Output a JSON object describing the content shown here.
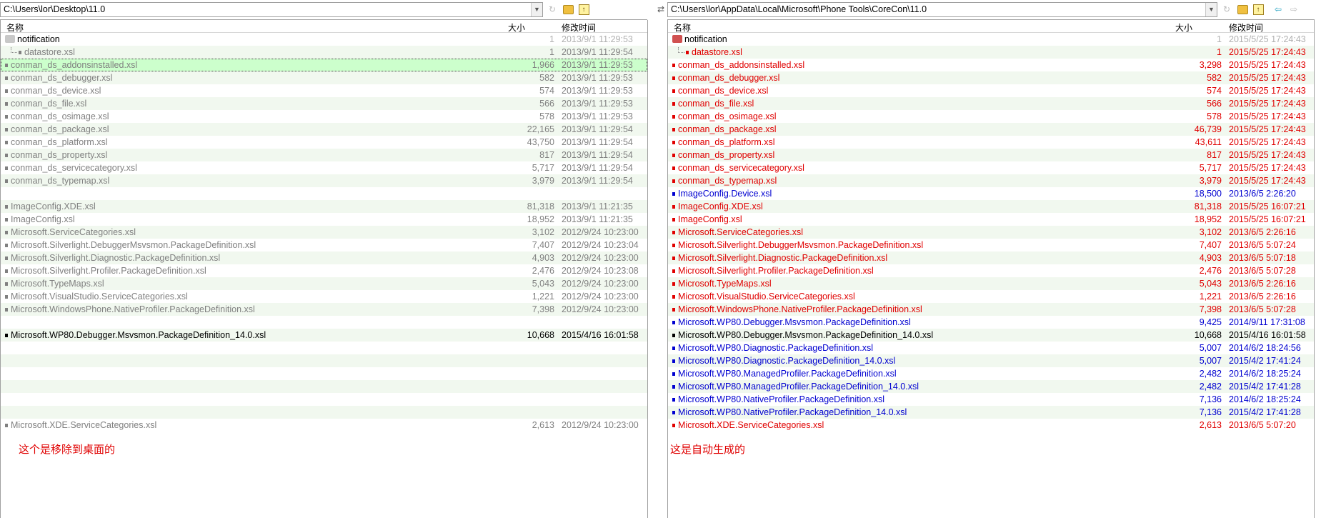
{
  "left": {
    "path": "C:\\Users\\lor\\Desktop\\11.0",
    "headers": {
      "name": "名称",
      "size": "大小",
      "date": "修改时间"
    },
    "note": "这个是移除到桌面的"
  },
  "right": {
    "path": "C:\\Users\\lor\\AppData\\Local\\Microsoft\\Phone Tools\\CoreCon\\11.0",
    "headers": {
      "name": "名称",
      "size": "大小",
      "date": "修改时间"
    },
    "note": "这是自动生成的"
  },
  "colors": {
    "gray": "#808080",
    "red": "#e00000",
    "blue": "#0000d0",
    "black": "#000000",
    "dim": "#b0b0b0"
  },
  "rows": [
    {
      "type": "folder",
      "left": {
        "name": "notification",
        "size": "1",
        "date": "2013/9/1 11:29:53",
        "color": "black",
        "meta": "dim"
      },
      "right": {
        "name": "notification",
        "size": "1",
        "date": "2015/5/25 17:24:43",
        "color": "black",
        "meta": "dim"
      }
    },
    {
      "type": "child",
      "left": {
        "name": "datastore.xsl",
        "size": "1",
        "date": "2013/9/1 11:29:54",
        "color": "gray"
      },
      "right": {
        "name": "datastore.xsl",
        "size": "1",
        "date": "2015/5/25 17:24:43",
        "color": "red"
      }
    },
    {
      "selected": true,
      "left": {
        "name": "conman_ds_addonsinstalled.xsl",
        "size": "1,966",
        "date": "2013/9/1 11:29:53",
        "color": "gray"
      },
      "right": {
        "name": "conman_ds_addonsinstalled.xsl",
        "size": "3,298",
        "date": "2015/5/25 17:24:43",
        "color": "red"
      }
    },
    {
      "left": {
        "name": "conman_ds_debugger.xsl",
        "size": "582",
        "date": "2013/9/1 11:29:53",
        "color": "gray"
      },
      "right": {
        "name": "conman_ds_debugger.xsl",
        "size": "582",
        "date": "2015/5/25 17:24:43",
        "color": "red"
      }
    },
    {
      "left": {
        "name": "conman_ds_device.xsl",
        "size": "574",
        "date": "2013/9/1 11:29:53",
        "color": "gray"
      },
      "right": {
        "name": "conman_ds_device.xsl",
        "size": "574",
        "date": "2015/5/25 17:24:43",
        "color": "red"
      }
    },
    {
      "left": {
        "name": "conman_ds_file.xsl",
        "size": "566",
        "date": "2013/9/1 11:29:53",
        "color": "gray"
      },
      "right": {
        "name": "conman_ds_file.xsl",
        "size": "566",
        "date": "2015/5/25 17:24:43",
        "color": "red"
      }
    },
    {
      "left": {
        "name": "conman_ds_osimage.xsl",
        "size": "578",
        "date": "2013/9/1 11:29:53",
        "color": "gray"
      },
      "right": {
        "name": "conman_ds_osimage.xsl",
        "size": "578",
        "date": "2015/5/25 17:24:43",
        "color": "red"
      }
    },
    {
      "left": {
        "name": "conman_ds_package.xsl",
        "size": "22,165",
        "date": "2013/9/1 11:29:54",
        "color": "gray"
      },
      "right": {
        "name": "conman_ds_package.xsl",
        "size": "46,739",
        "date": "2015/5/25 17:24:43",
        "color": "red"
      }
    },
    {
      "left": {
        "name": "conman_ds_platform.xsl",
        "size": "43,750",
        "date": "2013/9/1 11:29:54",
        "color": "gray"
      },
      "right": {
        "name": "conman_ds_platform.xsl",
        "size": "43,611",
        "date": "2015/5/25 17:24:43",
        "color": "red"
      }
    },
    {
      "left": {
        "name": "conman_ds_property.xsl",
        "size": "817",
        "date": "2013/9/1 11:29:54",
        "color": "gray"
      },
      "right": {
        "name": "conman_ds_property.xsl",
        "size": "817",
        "date": "2015/5/25 17:24:43",
        "color": "red"
      }
    },
    {
      "left": {
        "name": "conman_ds_servicecategory.xsl",
        "size": "5,717",
        "date": "2013/9/1 11:29:54",
        "color": "gray"
      },
      "right": {
        "name": "conman_ds_servicecategory.xsl",
        "size": "5,717",
        "date": "2015/5/25 17:24:43",
        "color": "red"
      }
    },
    {
      "left": {
        "name": "conman_ds_typemap.xsl",
        "size": "3,979",
        "date": "2013/9/1 11:29:54",
        "color": "gray"
      },
      "right": {
        "name": "conman_ds_typemap.xsl",
        "size": "3,979",
        "date": "2015/5/25 17:24:43",
        "color": "red"
      }
    },
    {
      "left": null,
      "right": {
        "name": "ImageConfig.Device.xsl",
        "size": "18,500",
        "date": "2013/6/5 2:26:20",
        "color": "blue"
      }
    },
    {
      "left": {
        "name": "ImageConfig.XDE.xsl",
        "size": "81,318",
        "date": "2013/9/1 11:21:35",
        "color": "gray"
      },
      "right": {
        "name": "ImageConfig.XDE.xsl",
        "size": "81,318",
        "date": "2015/5/25 16:07:21",
        "color": "red"
      }
    },
    {
      "left": {
        "name": "ImageConfig.xsl",
        "size": "18,952",
        "date": "2013/9/1 11:21:35",
        "color": "gray"
      },
      "right": {
        "name": "ImageConfig.xsl",
        "size": "18,952",
        "date": "2015/5/25 16:07:21",
        "color": "red"
      }
    },
    {
      "left": {
        "name": "Microsoft.ServiceCategories.xsl",
        "size": "3,102",
        "date": "2012/9/24 10:23:00",
        "color": "gray"
      },
      "right": {
        "name": "Microsoft.ServiceCategories.xsl",
        "size": "3,102",
        "date": "2013/6/5 2:26:16",
        "color": "red"
      }
    },
    {
      "left": {
        "name": "Microsoft.Silverlight.DebuggerMsvsmon.PackageDefinition.xsl",
        "size": "7,407",
        "date": "2012/9/24 10:23:04",
        "color": "gray"
      },
      "right": {
        "name": "Microsoft.Silverlight.DebuggerMsvsmon.PackageDefinition.xsl",
        "size": "7,407",
        "date": "2013/6/5 5:07:24",
        "color": "red"
      }
    },
    {
      "left": {
        "name": "Microsoft.Silverlight.Diagnostic.PackageDefinition.xsl",
        "size": "4,903",
        "date": "2012/9/24 10:23:00",
        "color": "gray"
      },
      "right": {
        "name": "Microsoft.Silverlight.Diagnostic.PackageDefinition.xsl",
        "size": "4,903",
        "date": "2013/6/5 5:07:18",
        "color": "red"
      }
    },
    {
      "left": {
        "name": "Microsoft.Silverlight.Profiler.PackageDefinition.xsl",
        "size": "2,476",
        "date": "2012/9/24 10:23:08",
        "color": "gray"
      },
      "right": {
        "name": "Microsoft.Silverlight.Profiler.PackageDefinition.xsl",
        "size": "2,476",
        "date": "2013/6/5 5:07:28",
        "color": "red"
      }
    },
    {
      "left": {
        "name": "Microsoft.TypeMaps.xsl",
        "size": "5,043",
        "date": "2012/9/24 10:23:00",
        "color": "gray"
      },
      "right": {
        "name": "Microsoft.TypeMaps.xsl",
        "size": "5,043",
        "date": "2013/6/5 2:26:16",
        "color": "red"
      }
    },
    {
      "left": {
        "name": "Microsoft.VisualStudio.ServiceCategories.xsl",
        "size": "1,221",
        "date": "2012/9/24 10:23:00",
        "color": "gray"
      },
      "right": {
        "name": "Microsoft.VisualStudio.ServiceCategories.xsl",
        "size": "1,221",
        "date": "2013/6/5 2:26:16",
        "color": "red"
      }
    },
    {
      "left": {
        "name": "Microsoft.WindowsPhone.NativeProfiler.PackageDefinition.xsl",
        "size": "7,398",
        "date": "2012/9/24 10:23:00",
        "color": "gray"
      },
      "right": {
        "name": "Microsoft.WindowsPhone.NativeProfiler.PackageDefinition.xsl",
        "size": "7,398",
        "date": "2013/6/5 5:07:28",
        "color": "red"
      }
    },
    {
      "left": null,
      "right": {
        "name": "Microsoft.WP80.Debugger.Msvsmon.PackageDefinition.xsl",
        "size": "9,425",
        "date": "2014/9/11 17:31:08",
        "color": "blue"
      }
    },
    {
      "left": {
        "name": "Microsoft.WP80.Debugger.Msvsmon.PackageDefinition_14.0.xsl",
        "size": "10,668",
        "date": "2015/4/16 16:01:58",
        "color": "black"
      },
      "right": {
        "name": "Microsoft.WP80.Debugger.Msvsmon.PackageDefinition_14.0.xsl",
        "size": "10,668",
        "date": "2015/4/16 16:01:58",
        "color": "black"
      }
    },
    {
      "left": null,
      "right": {
        "name": "Microsoft.WP80.Diagnostic.PackageDefinition.xsl",
        "size": "5,007",
        "date": "2014/6/2 18:24:56",
        "color": "blue"
      }
    },
    {
      "left": null,
      "right": {
        "name": "Microsoft.WP80.Diagnostic.PackageDefinition_14.0.xsl",
        "size": "5,007",
        "date": "2015/4/2 17:41:24",
        "color": "blue"
      }
    },
    {
      "left": null,
      "right": {
        "name": "Microsoft.WP80.ManagedProfiler.PackageDefinition.xsl",
        "size": "2,482",
        "date": "2014/6/2 18:25:24",
        "color": "blue"
      }
    },
    {
      "left": null,
      "right": {
        "name": "Microsoft.WP80.ManagedProfiler.PackageDefinition_14.0.xsl",
        "size": "2,482",
        "date": "2015/4/2 17:41:28",
        "color": "blue"
      }
    },
    {
      "left": null,
      "right": {
        "name": "Microsoft.WP80.NativeProfiler.PackageDefinition.xsl",
        "size": "7,136",
        "date": "2014/6/2 18:25:24",
        "color": "blue"
      }
    },
    {
      "left": null,
      "right": {
        "name": "Microsoft.WP80.NativeProfiler.PackageDefinition_14.0.xsl",
        "size": "7,136",
        "date": "2015/4/2 17:41:28",
        "color": "blue"
      }
    },
    {
      "left": {
        "name": "Microsoft.XDE.ServiceCategories.xsl",
        "size": "2,613",
        "date": "2012/9/24 10:23:00",
        "color": "gray"
      },
      "right": {
        "name": "Microsoft.XDE.ServiceCategories.xsl",
        "size": "2,613",
        "date": "2013/6/5 5:07:20",
        "color": "red"
      }
    }
  ]
}
